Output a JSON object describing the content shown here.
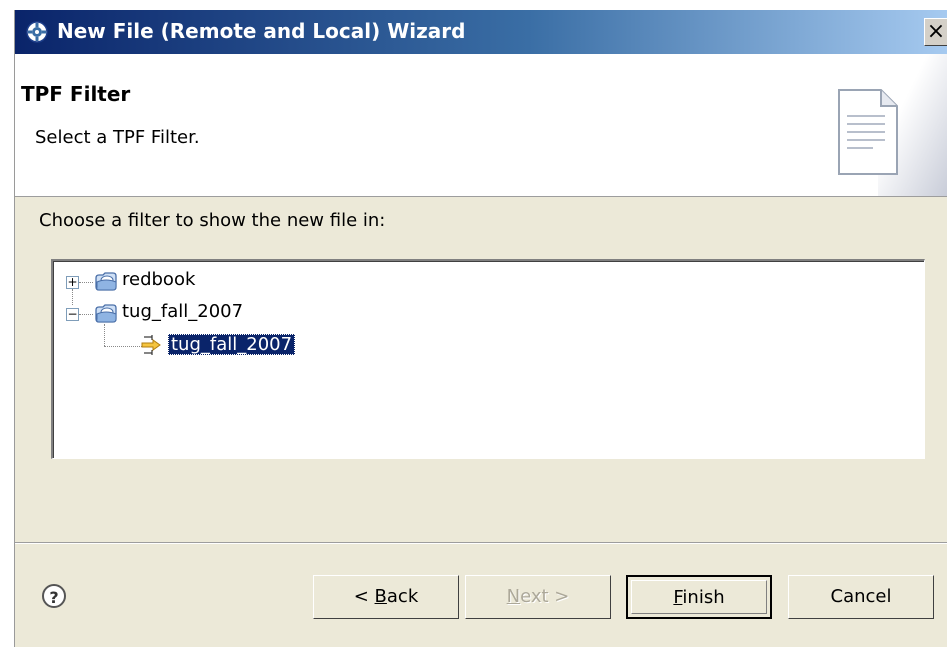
{
  "window": {
    "title": "New File (Remote and Local) Wizard",
    "close_glyph": "×"
  },
  "header": {
    "title": "TPF Filter",
    "description": "Select a TPF Filter."
  },
  "main": {
    "prompt": "Choose a filter to show the new file in:",
    "tree": [
      {
        "label": "redbook",
        "expanded": false,
        "expander": "+"
      },
      {
        "label": "tug_fall_2007",
        "expanded": true,
        "expander": "−",
        "children": [
          {
            "label": "tug_fall_2007",
            "selected": true
          }
        ]
      }
    ]
  },
  "footer": {
    "help_glyph": "?",
    "back": {
      "prefix": "< ",
      "mnemonic": "B",
      "rest": "ack"
    },
    "next": {
      "mnemonic": "N",
      "rest": "ext >",
      "enabled": false
    },
    "finish": {
      "mnemonic": "F",
      "rest": "inish",
      "default": true
    },
    "cancel": {
      "label": "Cancel"
    }
  },
  "colors": {
    "title_bar_start": "#0a246a",
    "title_bar_end": "#a6caf0",
    "dialog_bg": "#ece9d8",
    "selection": "#0a246a"
  },
  "icons": [
    "gear-icon",
    "document-icon",
    "filter-folder-icon",
    "filter-arrow-icon",
    "help-icon"
  ]
}
